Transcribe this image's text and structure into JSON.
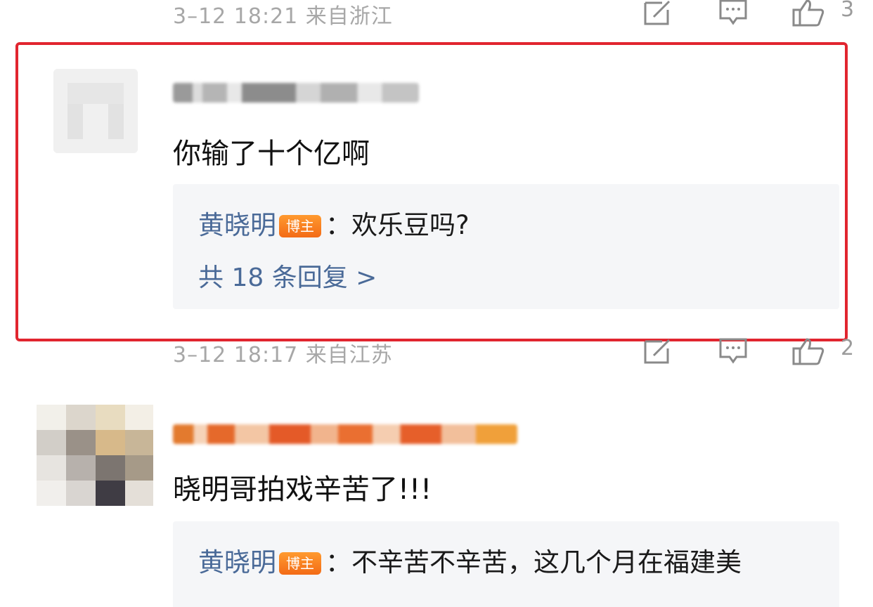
{
  "rows": [
    {
      "meta": "3–12 18:21  来自浙江",
      "like_count": "3"
    },
    {
      "meta": "3–12 18:17  来自江苏",
      "like_count": "2"
    }
  ],
  "comments": [
    {
      "text": "你输了十个亿啊",
      "reply": {
        "author": "黄晓明",
        "badge": "博主",
        "text": "：欢乐豆吗?"
      },
      "reply_count": "共 18 条回复 >"
    },
    {
      "text": "晓明哥拍戏辛苦了!!!",
      "reply": {
        "author": "黄晓明",
        "badge": "博主",
        "text": "：不辛苦不辛苦，这几个月在福建美"
      }
    }
  ],
  "icons": {
    "repost": "edit-icon",
    "comment": "comment-icon",
    "like": "thumbs-up-icon"
  },
  "colors": {
    "highlight": "#e1252f",
    "link": "#4a6a98",
    "badge": "#f36b16",
    "meta": "#a7a7a7"
  }
}
